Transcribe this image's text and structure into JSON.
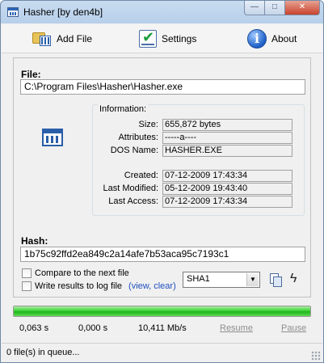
{
  "window": {
    "title": "Hasher  [by den4b]",
    "minimize_glyph": "—",
    "maximize_glyph": "□",
    "close_glyph": "✕"
  },
  "toolbar": {
    "add_file_label": "Add File",
    "settings_label": "Settings",
    "about_label": "About",
    "about_glyph": "i"
  },
  "file": {
    "label": "File:",
    "path": "C:\\Program Files\\Hasher\\Hasher.exe"
  },
  "information": {
    "group_title": "Information:",
    "rows": [
      {
        "key": "Size:",
        "value": "655,872 bytes"
      },
      {
        "key": "Attributes:",
        "value": "-----a----"
      },
      {
        "key": "DOS Name:",
        "value": "HASHER.EXE"
      },
      {
        "key": "Created:",
        "value": "07-12-2009 17:43:34"
      },
      {
        "key": "Last Modified:",
        "value": "05-12-2009 19:43:40"
      },
      {
        "key": "Last Access:",
        "value": "07-12-2009 17:43:34"
      }
    ]
  },
  "hash": {
    "label": "Hash:",
    "value": "1b75c92ffd2ea849c2a14afe7b53aca95c7193c1"
  },
  "options": {
    "compare_label": "Compare to the next file",
    "compare_checked": false,
    "log_label": "Write results to log file",
    "log_checked": false,
    "log_links_open": "(",
    "log_view": "view",
    "log_sep": ", ",
    "log_clear": "clear",
    "log_links_close": ")",
    "algorithm": "SHA1",
    "dropdown_glyph": "▼",
    "bolt_glyph": "ϟ"
  },
  "progress": {
    "percent": 100,
    "elapsed": "0,063 s",
    "remaining": "0,000 s",
    "speed": "10,411 Mb/s",
    "resume_label": "Resume",
    "pause_label": "Pause"
  },
  "status": {
    "queue_text": "0 file(s) in queue..."
  },
  "colors": {
    "progress_green": "#1eb51b",
    "link_blue": "#1f4fbf",
    "title_bar": "#b7cfea"
  }
}
